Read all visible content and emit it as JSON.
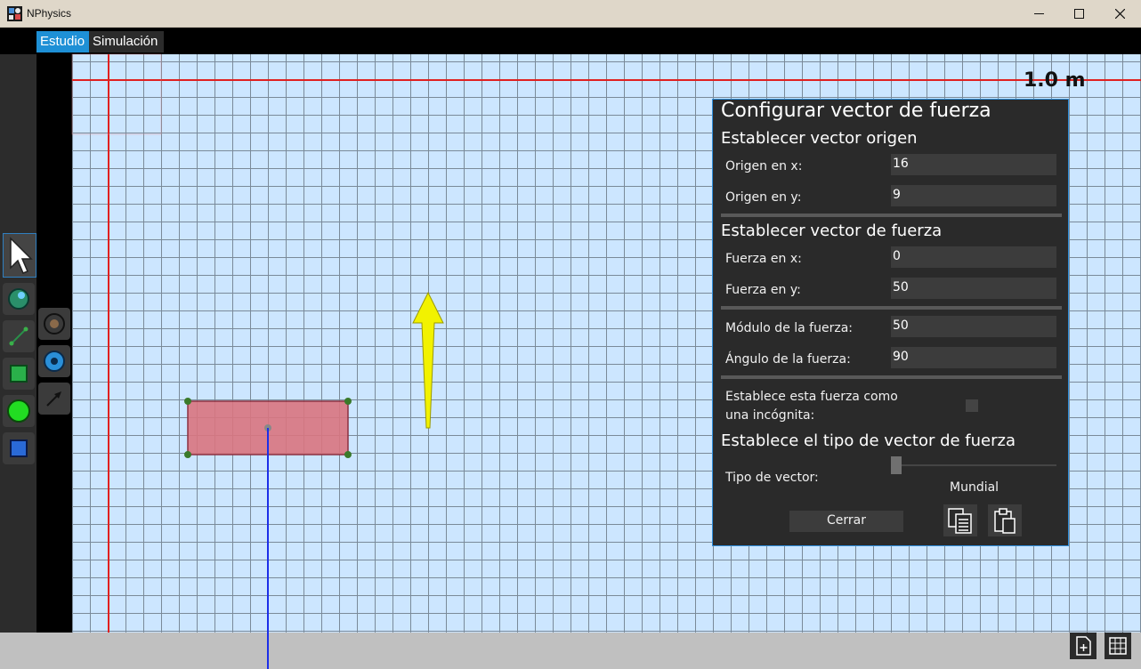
{
  "window": {
    "title": "NPhysics"
  },
  "menu": {
    "tabs": [
      "Estudio",
      "Simulación"
    ]
  },
  "canvas": {
    "scale_label": "1.0 m"
  },
  "dialog": {
    "title": "Configurar vector de fuerza",
    "section_origin": "Establecer vector origen",
    "origin_x_label": "Origen en x:",
    "origin_x_value": "16",
    "origin_y_label": "Origen en y:",
    "origin_y_value": "9",
    "section_force": "Establecer vector de fuerza",
    "force_x_label": "Fuerza en x:",
    "force_x_value": "0",
    "force_y_label": "Fuerza en y:",
    "force_y_value": "50",
    "module_label": "Módulo de la fuerza:",
    "module_value": "50",
    "angle_label": "Ángulo de la fuerza:",
    "angle_value": "90",
    "unknown_label_line1": "Establece esta fuerza como",
    "unknown_label_line2": "una incógnita:",
    "unknown_checked": false,
    "section_type": "Establece el tipo de vector de fuerza",
    "type_label": "Tipo de vector:",
    "type_value": "Mundial",
    "type_slider_position": 0,
    "close_label": "Cerrar"
  },
  "colors": {
    "accent": "#1e90d6",
    "canvas_bg": "#cce6ff",
    "axis_red": "#e02020",
    "axis_blue": "#1c2ee8",
    "body_fill": "#d9747f",
    "force_arrow": "#f2f200"
  },
  "icons": {
    "select_tool": "cursor-arrow-icon",
    "tools": [
      "globe-tool-icon",
      "line-tool-icon",
      "green-square-tool-icon",
      "green-circle-tool-icon",
      "blue-square-tool-icon",
      "dark-sphere-tool-icon",
      "blue-disc-tool-icon",
      "arrow-tool-icon"
    ],
    "copy": "copy-icon",
    "paste": "clipboard-icon",
    "new_file": "new-file-icon",
    "grid": "grid-icon"
  }
}
